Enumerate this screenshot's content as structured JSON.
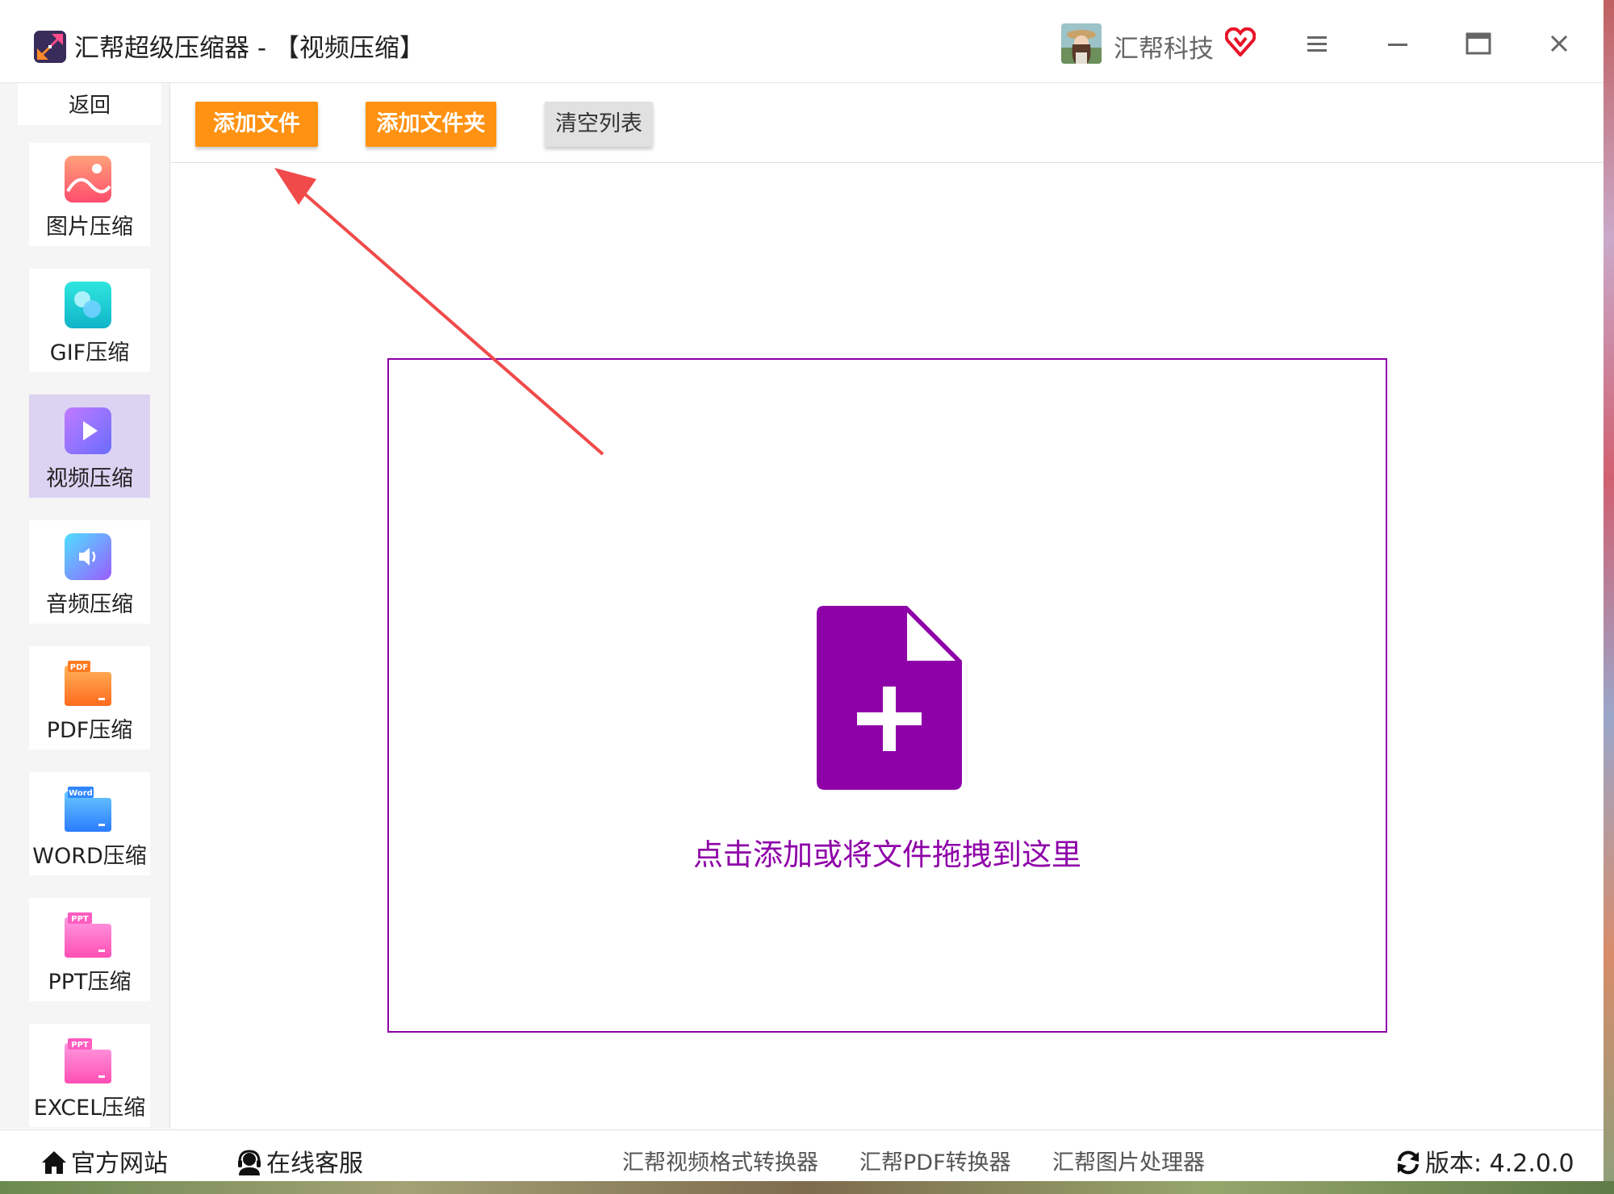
{
  "window": {
    "app_title": "汇帮超级压缩器   -  【视频压缩】",
    "user_name": "汇帮科技",
    "icons": {
      "app_logo": "compress-arrows-icon",
      "avatar": "user-avatar",
      "vip": "vip-heart-icon",
      "menu": "hamburger-menu-icon",
      "minimize": "minimize-icon",
      "maximize": "maximize-icon",
      "close": "close-icon"
    }
  },
  "sidebar": {
    "back_label": "返回",
    "items": [
      {
        "label": "图片压缩",
        "icon": "image-icon",
        "active": false
      },
      {
        "label": "GIF压缩",
        "icon": "gif-icon",
        "active": false
      },
      {
        "label": "视频压缩",
        "icon": "video-play-icon",
        "active": true
      },
      {
        "label": "音频压缩",
        "icon": "audio-speaker-icon",
        "active": false
      },
      {
        "label": "PDF压缩",
        "icon": "pdf-folder-icon",
        "badge": "PDF",
        "active": false
      },
      {
        "label": "WORD压缩",
        "icon": "word-folder-icon",
        "badge": "Word",
        "active": false
      },
      {
        "label": "PPT压缩",
        "icon": "ppt-folder-icon",
        "badge": "PPT",
        "active": false
      },
      {
        "label": "EXCEL压缩",
        "icon": "excel-folder-icon",
        "badge": "PPT",
        "active": false
      }
    ]
  },
  "toolbar": {
    "add_file_label": "添加文件",
    "add_folder_label": "添加文件夹",
    "clear_list_label": "清空列表"
  },
  "dropzone": {
    "icon": "file-add-icon",
    "text": "点击添加或将文件拖拽到这里"
  },
  "footer": {
    "website_label": "官方网站",
    "support_label": "在线客服",
    "link_video_converter": "汇帮视频格式转换器",
    "link_pdf_converter": "汇帮PDF转换器",
    "link_image_processor": "汇帮图片处理器",
    "version_label": "版本:  4.2.0.0",
    "icons": {
      "website": "home-icon",
      "support": "headset-icon",
      "version": "refresh-icon"
    }
  },
  "colors": {
    "accent_orange": "#ff9212",
    "accent_purple": "#8e00a8",
    "annotation_arrow": "#f04a4a",
    "active_nav_bg": "#dcd3f3"
  }
}
